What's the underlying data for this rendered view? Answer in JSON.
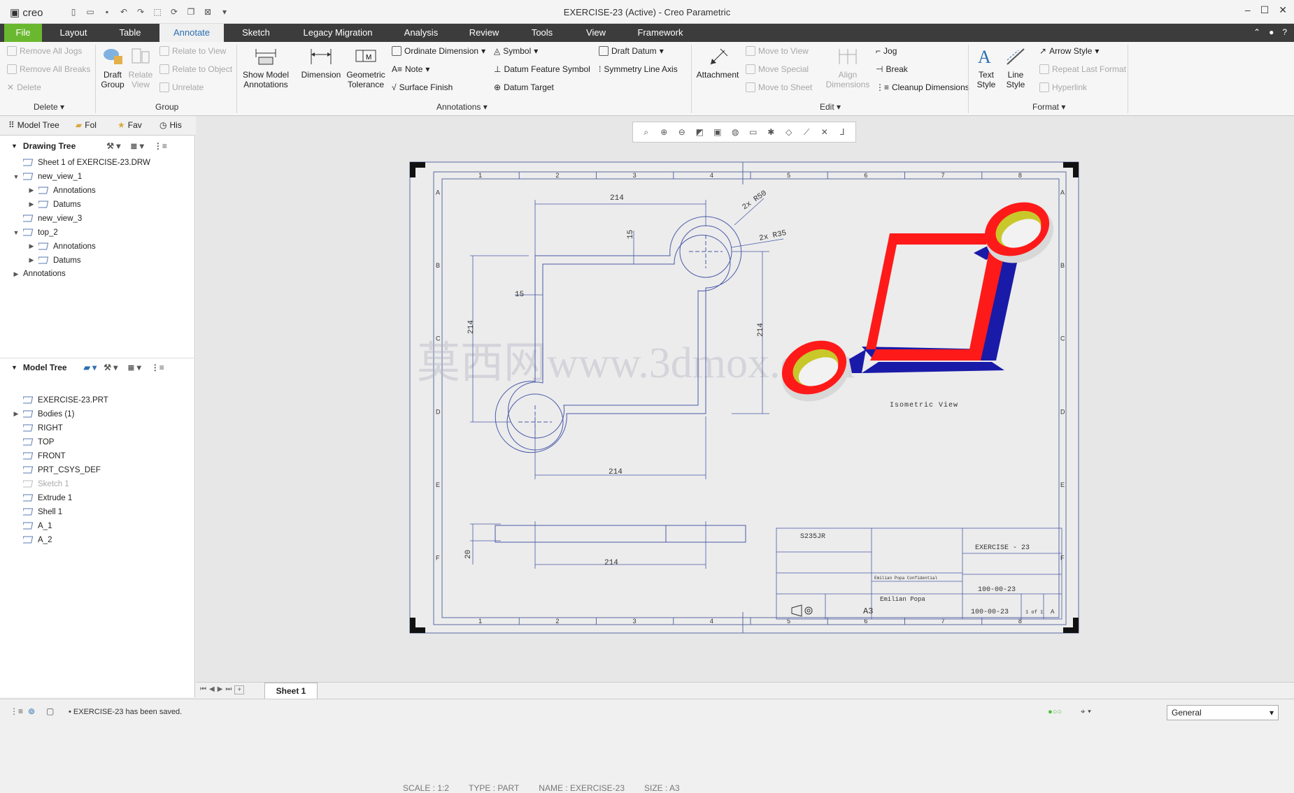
{
  "app": {
    "logo": "creo",
    "window_title": "EXERCISE-23 (Active) - Creo Parametric"
  },
  "menu": {
    "tabs": [
      "File",
      "Layout",
      "Table",
      "Annotate",
      "Sketch",
      "Legacy Migration",
      "Analysis",
      "Review",
      "Tools",
      "View",
      "Framework"
    ],
    "active": "Annotate"
  },
  "ribbon": {
    "delete_group": {
      "items": [
        "Remove All Jogs",
        "Remove All Breaks",
        "Delete"
      ],
      "label": "Delete"
    },
    "group_group": {
      "draft_group": "Draft\nGroup",
      "relate_view": "Relate\nView",
      "items": [
        "Relate to View",
        "Relate to Object",
        "Unrelate"
      ],
      "label": "Group"
    },
    "annotations_group": {
      "show_model": "Show Model\nAnnotations",
      "dimension": "Dimension",
      "geometric_tolerance": "Geometric\nTolerance",
      "items": [
        "Ordinate Dimension",
        "Note",
        "Surface Finish",
        "Symbol",
        "Datum Feature Symbol",
        "Datum Target",
        "Draft Datum",
        "Symmetry Line Axis"
      ],
      "label": "Annotations"
    },
    "edit_group": {
      "attachment": "Attachment",
      "items": [
        "Move to View",
        "Move Special",
        "Move to Sheet"
      ],
      "align": "Align\nDimensions",
      "items2": [
        "Jog",
        "Break",
        "Cleanup Dimensions"
      ],
      "label": "Edit"
    },
    "format_group": {
      "text_style": "Text\nStyle",
      "line_style": "Line\nStyle",
      "items": [
        "Arrow Style",
        "Repeat Last Format",
        "Hyperlink"
      ],
      "label": "Format"
    }
  },
  "left_panel": {
    "tabs": [
      "Model Tree",
      "Fol",
      "Fav",
      "His"
    ],
    "drawing_tree": {
      "title": "Drawing Tree",
      "items": [
        {
          "label": "Sheet 1 of EXERCISE-23.DRW",
          "indent": 0,
          "toggle": ""
        },
        {
          "label": "new_view_1",
          "indent": 0,
          "toggle": "▼"
        },
        {
          "label": "Annotations",
          "indent": 1,
          "toggle": "▶"
        },
        {
          "label": "Datums",
          "indent": 1,
          "toggle": "▶"
        },
        {
          "label": "new_view_3",
          "indent": 0,
          "toggle": ""
        },
        {
          "label": "top_2",
          "indent": 0,
          "toggle": "▼"
        },
        {
          "label": "Annotations",
          "indent": 1,
          "toggle": "▶"
        },
        {
          "label": "Datums",
          "indent": 1,
          "toggle": "▶"
        },
        {
          "label": "Annotations",
          "indent": -1,
          "toggle": "▶"
        }
      ]
    },
    "model_tree": {
      "title": "Model Tree",
      "items": [
        {
          "label": "EXERCISE-23.PRT",
          "indent": 0,
          "toggle": ""
        },
        {
          "label": "Bodies (1)",
          "indent": 0,
          "toggle": "▶"
        },
        {
          "label": "RIGHT",
          "indent": 0,
          "toggle": ""
        },
        {
          "label": "TOP",
          "indent": 0,
          "toggle": ""
        },
        {
          "label": "FRONT",
          "indent": 0,
          "toggle": ""
        },
        {
          "label": "PRT_CSYS_DEF",
          "indent": 0,
          "toggle": ""
        },
        {
          "label": "Sketch 1",
          "indent": 0,
          "toggle": "",
          "dim": true
        },
        {
          "label": "Extrude 1",
          "indent": 0,
          "toggle": ""
        },
        {
          "label": "Shell 1",
          "indent": 0,
          "toggle": ""
        },
        {
          "label": "A_1",
          "indent": 0,
          "toggle": ""
        },
        {
          "label": "A_2",
          "indent": 0,
          "toggle": ""
        }
      ]
    }
  },
  "drawing": {
    "col_labels": [
      "1",
      "2",
      "3",
      "4",
      "5",
      "6",
      "7",
      "8"
    ],
    "row_labels": [
      "A",
      "B",
      "C",
      "D",
      "E",
      "F"
    ],
    "dims": {
      "top": "214",
      "right": "214",
      "left": "214",
      "bottom": "214",
      "small15_v": "15",
      "small15_h": "15",
      "r50": "2x R50",
      "r35": "2x R35",
      "front_w": "214",
      "front_h": "20"
    },
    "iso_label": "Isometric View",
    "watermark": "莫西网www.3dmox.com",
    "title_block": {
      "material": "S235JR",
      "description": "EXERCISE - 23",
      "confidential": "Emilian Popa Confidential",
      "author": "Emilian Popa",
      "part_number": "100-00-23",
      "drawing_number": "100-00-23",
      "size": "A3",
      "sheet": "1 of 1",
      "revision": "A"
    }
  },
  "info": {
    "scale": "SCALE : 1:2",
    "type": "TYPE : PART",
    "name": "NAME : EXERCISE-23",
    "size": "SIZE : A3"
  },
  "sheet_tab": "Sheet 1",
  "status": {
    "message": "EXERCISE-23 has been saved.",
    "filter": "General"
  },
  "colors": {
    "red": "#ff1a1a",
    "blue": "#1a1aa8",
    "yellow": "#c8c82a",
    "line": "#4a5aa8"
  }
}
